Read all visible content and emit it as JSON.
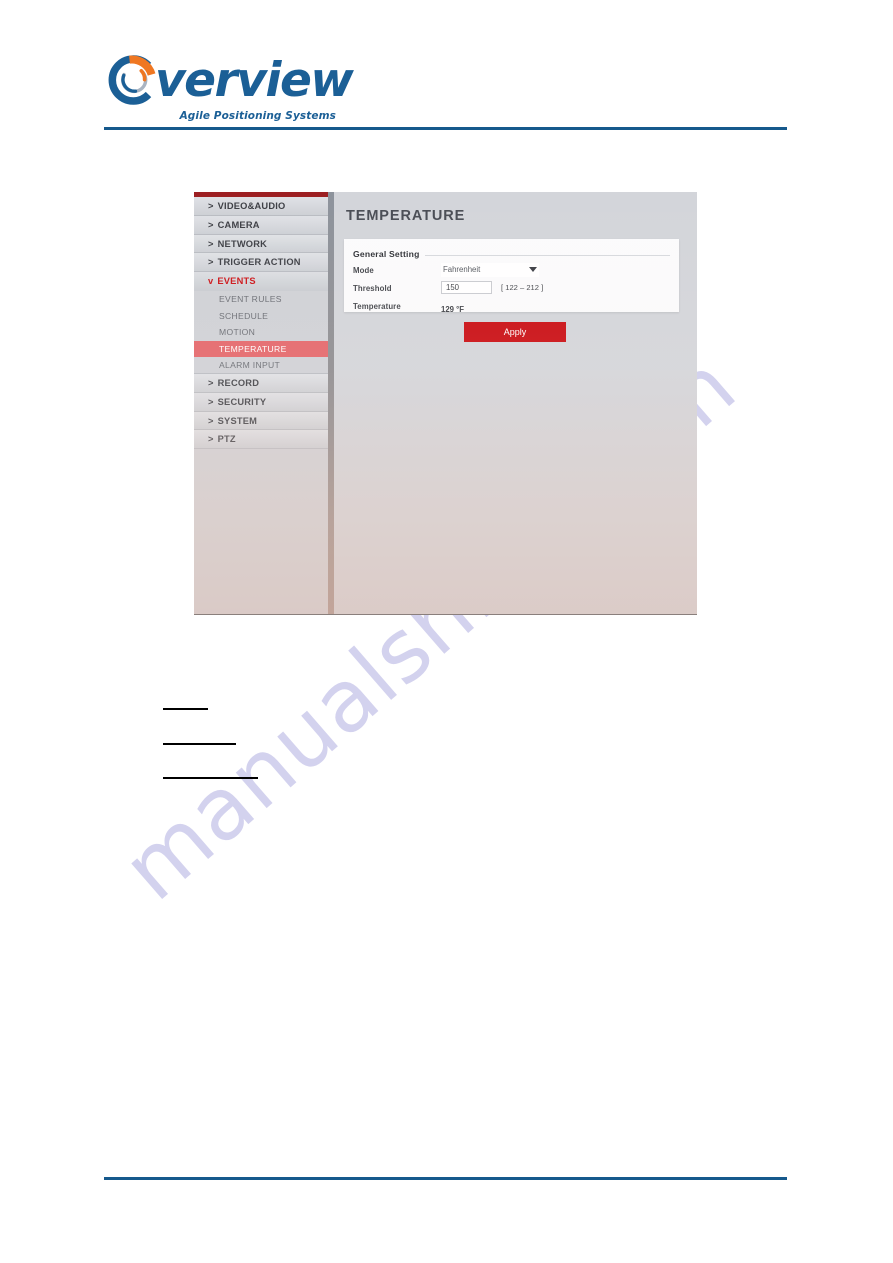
{
  "header": {
    "logo_word": "verview",
    "logo_tagline": "Agile Positioning Systems",
    "logo_mark_name": "overview-circular-logo"
  },
  "screenshot": {
    "sidebar": {
      "items": [
        {
          "chevron": ">",
          "label": "VIDEO&AUDIO",
          "state": "collapsed"
        },
        {
          "chevron": ">",
          "label": "CAMERA",
          "state": "collapsed"
        },
        {
          "chevron": ">",
          "label": "NETWORK",
          "state": "collapsed"
        },
        {
          "chevron": ">",
          "label": "TRIGGER ACTION",
          "state": "collapsed"
        },
        {
          "chevron": "v",
          "label": "EVENTS",
          "state": "expanded"
        },
        {
          "chevron": ">",
          "label": "RECORD",
          "state": "collapsed"
        },
        {
          "chevron": ">",
          "label": "SECURITY",
          "state": "collapsed"
        },
        {
          "chevron": ">",
          "label": "SYSTEM",
          "state": "collapsed"
        },
        {
          "chevron": ">",
          "label": "PTZ",
          "state": "collapsed"
        }
      ],
      "events_subitems": [
        {
          "label": "EVENT RULES",
          "active": false
        },
        {
          "label": "SCHEDULE",
          "active": false
        },
        {
          "label": "MOTION",
          "active": false
        },
        {
          "label": "TEMPERATURE",
          "active": true
        },
        {
          "label": "ALARM INPUT",
          "active": false
        }
      ]
    },
    "content": {
      "title": "TEMPERATURE",
      "card_title": "General Setting",
      "fields": {
        "mode_label": "Mode",
        "mode_value": "Fahrenheit",
        "threshold_label": "Threshold",
        "threshold_value": "150",
        "threshold_range": "[ 122 – 212 ]",
        "temperature_label": "Temperature",
        "temperature_value": "129 °F"
      },
      "apply_label": "Apply"
    }
  },
  "watermark": {
    "text": "manualshive.com"
  },
  "colors": {
    "brand_blue": "#16598c",
    "brand_orange": "#ef7722",
    "accent_red": "#c90c12",
    "active_nav": "#e4666a",
    "events_red": "#cc1418"
  }
}
